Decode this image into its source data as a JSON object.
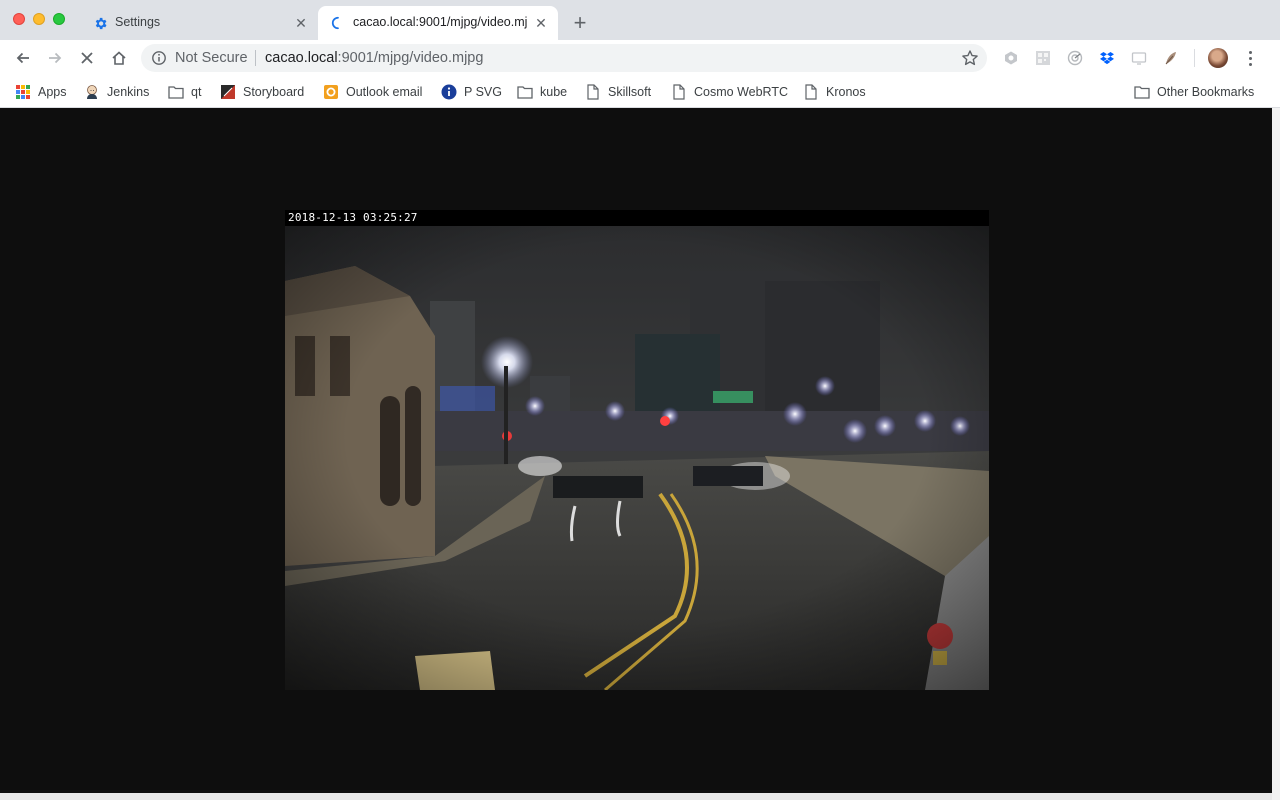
{
  "window": {
    "controls": [
      "close",
      "minimize",
      "maximize"
    ]
  },
  "tabs": [
    {
      "title": "Settings",
      "icon": "gear-icon",
      "active": false
    },
    {
      "title": "cacao.local:9001/mjpg/video.mjpg",
      "icon": "loading-spinner-icon",
      "active": true
    }
  ],
  "toolbar": {
    "security_label": "Not Secure",
    "url_host": "cacao.local",
    "url_rest": ":9001/mjpg/video.mjpg"
  },
  "bookmarks": [
    {
      "label": "Apps",
      "icon": "apps-grid-icon"
    },
    {
      "label": "Jenkins",
      "icon": "jenkins-icon"
    },
    {
      "label": "qt",
      "icon": "folder-icon"
    },
    {
      "label": "Storyboard",
      "icon": "storyboard-icon"
    },
    {
      "label": "Outlook email",
      "icon": "outlook-icon"
    },
    {
      "label": "P SVG",
      "icon": "info-circle-icon"
    },
    {
      "label": "kube",
      "icon": "folder-icon"
    },
    {
      "label": "Skillsoft",
      "icon": "page-icon"
    },
    {
      "label": "Cosmo WebRTC",
      "icon": "page-icon"
    },
    {
      "label": "Kronos",
      "icon": "page-icon"
    }
  ],
  "other_bookmarks_label": "Other Bookmarks",
  "video": {
    "timestamp": "2018-12-13 03:25:27"
  },
  "colors": {
    "tabstrip": "#dee1e6",
    "page_background": "#0e0e0e",
    "accent_blue": "#1a73e8"
  }
}
